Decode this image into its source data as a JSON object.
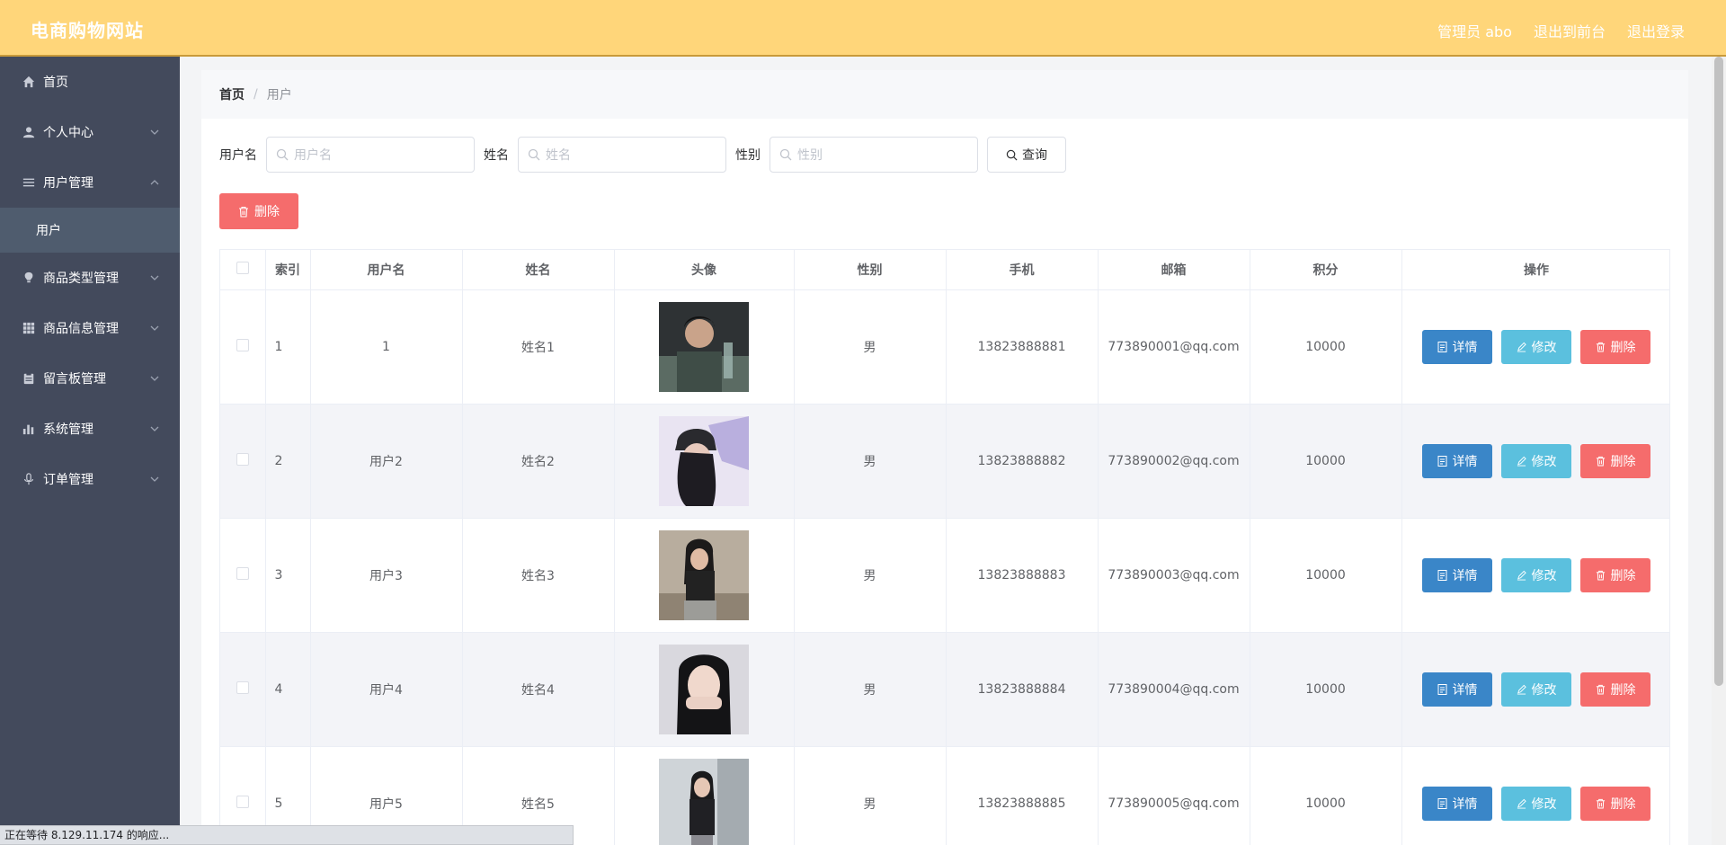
{
  "header": {
    "brand": "电商购物网站",
    "admin": "管理员 abo",
    "to_front": "退出到前台",
    "logout": "退出登录"
  },
  "sidebar": {
    "items": [
      {
        "label": "首页",
        "icon": "home-icon"
      },
      {
        "label": "个人中心",
        "icon": "user-icon"
      },
      {
        "label": "用户管理",
        "icon": "menu-icon"
      },
      {
        "label": "商品类型管理",
        "icon": "bulb-icon"
      },
      {
        "label": "商品信息管理",
        "icon": "grid-icon"
      },
      {
        "label": "留言板管理",
        "icon": "clipboard-icon"
      },
      {
        "label": "系统管理",
        "icon": "chart-icon"
      },
      {
        "label": "订单管理",
        "icon": "mic-icon"
      }
    ],
    "active_sub": "用户"
  },
  "breadcrumb": {
    "home": "首页",
    "sep": "/",
    "current": "用户"
  },
  "search": {
    "username_label": "用户名",
    "username_placeholder": "用户名",
    "username_value": "",
    "name_label": "姓名",
    "name_placeholder": "姓名",
    "name_value": "",
    "gender_label": "性别",
    "gender_placeholder": "性别",
    "gender_value": "",
    "query_label": "查询"
  },
  "toolbar": {
    "delete_label": "删除"
  },
  "table": {
    "headers": [
      "索引",
      "用户名",
      "姓名",
      "头像",
      "性别",
      "手机",
      "邮箱",
      "积分",
      "操作"
    ],
    "rows": [
      {
        "index": "1",
        "username": "1",
        "name": "姓名1",
        "gender": "男",
        "phone": "13823888881",
        "email": "773890001@qq.com",
        "points": "10000"
      },
      {
        "index": "2",
        "username": "用户2",
        "name": "姓名2",
        "gender": "男",
        "phone": "13823888882",
        "email": "773890002@qq.com",
        "points": "10000"
      },
      {
        "index": "3",
        "username": "用户3",
        "name": "姓名3",
        "gender": "男",
        "phone": "13823888883",
        "email": "773890003@qq.com",
        "points": "10000"
      },
      {
        "index": "4",
        "username": "用户4",
        "name": "姓名4",
        "gender": "男",
        "phone": "13823888884",
        "email": "773890004@qq.com",
        "points": "10000"
      },
      {
        "index": "5",
        "username": "用户5",
        "name": "姓名5",
        "gender": "男",
        "phone": "13823888885",
        "email": "773890005@qq.com",
        "points": "10000"
      }
    ],
    "actions": {
      "detail": "详情",
      "edit": "修改",
      "delete": "删除"
    }
  },
  "status": {
    "text": "正在等待 8.129.11.174 的响应..."
  },
  "colors": {
    "header_bg": "#ffd67a",
    "sidebar_bg": "#434a5c",
    "danger": "#f56c6c",
    "primary": "#3a86c8",
    "info": "#5bc0de"
  }
}
